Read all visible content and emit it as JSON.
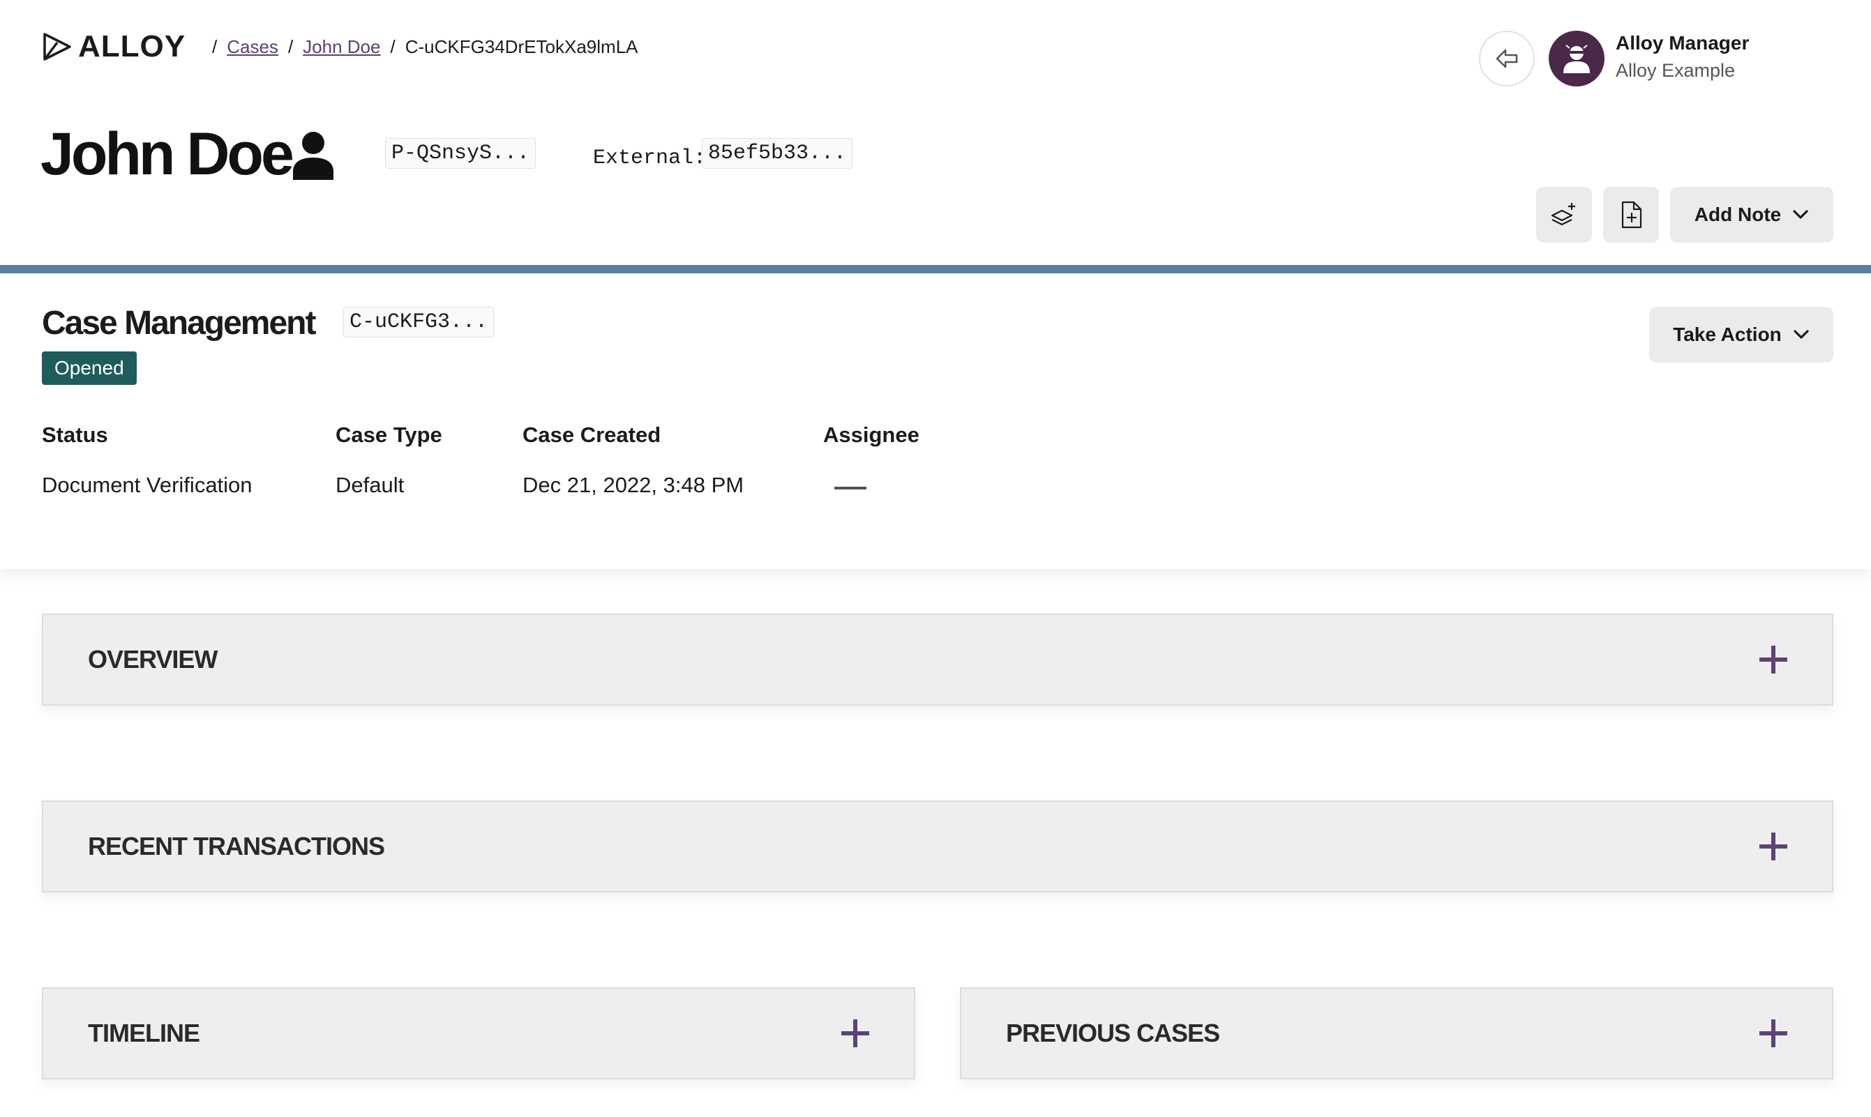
{
  "header": {
    "logo_text": "ALLOY",
    "breadcrumb": {
      "sep": "/",
      "cases": "Cases",
      "entity": "John Doe",
      "current": "C-uCKFG34DrETokXa9lmLA"
    },
    "user": {
      "name": "Alloy Manager",
      "org": "Alloy Example"
    }
  },
  "entity": {
    "name": "John Doe",
    "id_short": "P-QSnsyS...",
    "external_label": "External:",
    "external_id": "85ef5b33...",
    "add_note_label": "Add Note"
  },
  "case": {
    "title": "Case Management",
    "id_short": "C-uCKFG3...",
    "badge": "Opened",
    "take_action_label": "Take Action",
    "fields": {
      "status_label": "Status",
      "status_value": "Document Verification",
      "type_label": "Case Type",
      "type_value": "Default",
      "created_label": "Case Created",
      "created_value": "Dec 21, 2022, 3:48 PM",
      "assignee_label": "Assignee"
    }
  },
  "sections": {
    "overview": "OVERVIEW",
    "recent_transactions": "RECENT TRANSACTIONS",
    "timeline": "TIMELINE",
    "previous_cases": "PREVIOUS CASES"
  },
  "colors": {
    "accent_bar": "#5b7fa3",
    "badge_bg": "#1f5c5c",
    "plus_icon": "#5b4478",
    "avatar_bg": "#4a2848",
    "link": "#5a3f7a"
  }
}
